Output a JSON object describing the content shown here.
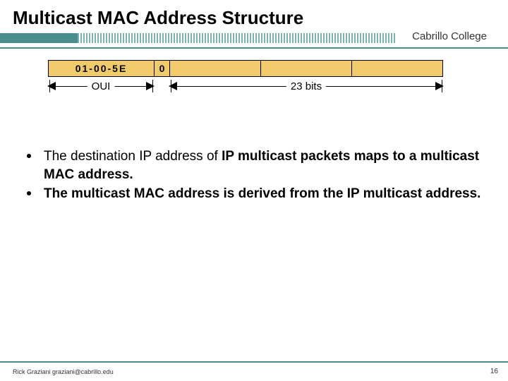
{
  "title": "Multicast MAC Address Structure",
  "brand": "Cabrillo College",
  "diagram": {
    "oui_hex": "01-00-5E",
    "fixed_bit": "0",
    "oui_label": "OUI",
    "bits_label": "23 bits"
  },
  "bullets": [
    {
      "pre": "The destination IP address of ",
      "bold": "IP multicast packets maps to a multicast MAC address.",
      "post": ""
    },
    {
      "pre": "",
      "bold": "The multicast MAC address is derived from the IP multicast address.",
      "post": ""
    }
  ],
  "footer": {
    "author": "Rick Graziani  graziani@cabrillo.edu",
    "page": "16"
  }
}
